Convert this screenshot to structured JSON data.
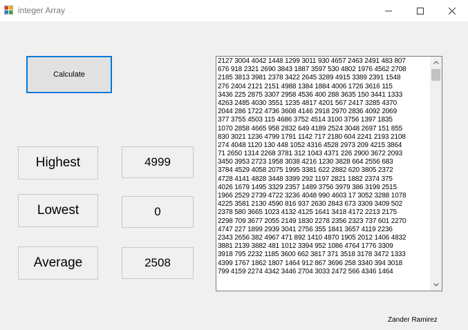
{
  "window": {
    "title": "integer Array",
    "icon": "app-form-icon"
  },
  "buttons": {
    "calculate_label": "Calculate"
  },
  "stats": {
    "highest_label": "Highest",
    "highest_value": "4999",
    "lowest_label": "Lowest",
    "lowest_value": "0",
    "average_label": "Average",
    "average_value": "2508"
  },
  "list": {
    "lines": [
      "2127 3004 4042 1448 1299 3011 930 4657 2463 2491 483 807",
      "676 918 2321 2690 3843 1887 3597 530 4802 1976 4562 2708",
      "2185 3813 3981 2378 3422 2645 3289 4915 3389 2391 1548",
      "276 2404 2121 2151 4988 1384 1884 4006 1726 3616 115",
      "3436 225 2875 3307 2958 4536 400 288 3635 150 3441 1333",
      "4263 2485 4030 3551 1235 4817 4201 567 2417 3285 4370",
      "2044 286 1722 4736 3608 4146 2918 2970 2836 4092 2069",
      "377 3755 4503 115 4686 3752 4514 3100 3756 1397 1835",
      "1070 2858 4665 958 2832 649 4189 2524 3048 2697 151 855",
      "830 3021 1236 4799 1791 1142 717 2180 604 2241 2193 2108",
      "274 4048 1120 130 448 1052 4316 4528 2973 209 4215 3864",
      "71 2650 1314 2268 3781 312 1043 4371 226 2900 3672 2093",
      "3450 3953 2723 1958 3038 4216 1230 3828 664 2556 683",
      "3784 4529 4058 2075 1995 3381 622 2882 620 3805 2372",
      "4728 4141 4828 3448 3399 292 1197 2821 1882 2374 375",
      "4026 1679 1495 3329 2357 1489 3756 3979 386 3199 2515",
      "1966 2529 2739 4722 3236 4048 990 4603 17 3052 3288 1078",
      "4225 3581 2130 4590 816 937 2630 2843 673 3309 3409 502",
      "2378 580 3665 1023 4132 4125 1641 3418 4172 2213 2175",
      "2298 709 3677 2055 2149 1830 2278 2356 2323 737 601 2270",
      "4747 227 1899 2939 3041 2756 355 1841 3657 4119 2236",
      "2343 2656 382 4967 471 892 1410 4870 1905 2012 1406 4832",
      "3881 2139 3882 481 1012 3394 952 1086 4764 1776 3309",
      "3918 795 2232 1185 3600 662 3817 371 3518 3178 3472 1333",
      "4399 1767 1862 1807 1464 912 867 3696 258 3340 394 3018",
      "799 4159 2274 4342 3446 2704 3033 2472 566 4346 1464"
    ]
  },
  "footer": {
    "author": "Zander Ramirez"
  }
}
